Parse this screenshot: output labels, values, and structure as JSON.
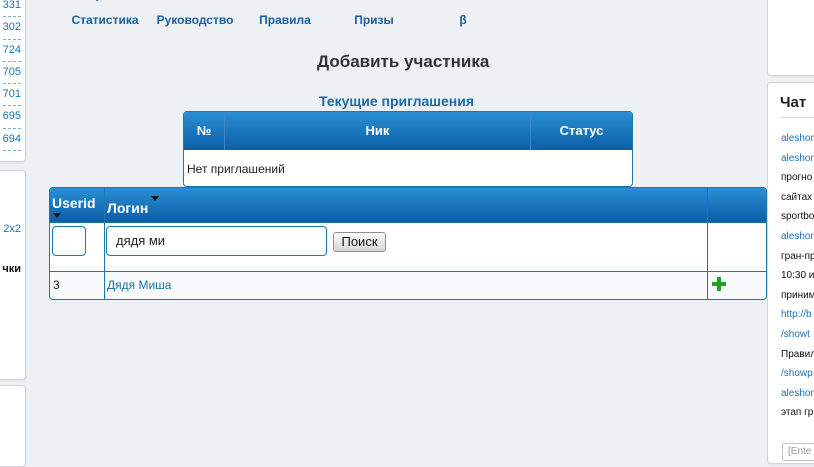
{
  "left_sidebar": {
    "numbers": [
      "331",
      "302",
      "724",
      "705",
      "701",
      "695",
      "694"
    ],
    "text1": "2x2",
    "text2": "чки"
  },
  "nav": {
    "items": [
      {
        "label": "Статистика",
        "icon": "chart-icon"
      },
      {
        "label": "Руководство",
        "icon": "manual-icon"
      },
      {
        "label": "Правила",
        "icon": "rules-icon"
      },
      {
        "label": "Призы",
        "icon": "gift-icon"
      },
      {
        "label": "β",
        "icon": "beta-icon"
      }
    ]
  },
  "page_title": "Добавить участника",
  "invitations": {
    "title": "Текущие приглашения",
    "columns": [
      "№",
      "Ник",
      "Статус"
    ],
    "empty_text": "Нет приглашений"
  },
  "users_table": {
    "columns": [
      "Userid",
      "Логин"
    ],
    "userid_filter_value": "",
    "login_filter_value": "дядя ми",
    "search_button": "Поиск",
    "rows": [
      {
        "id": "3",
        "login": "Дядя Миша"
      }
    ]
  },
  "chat": {
    "title": "Чат",
    "lines": [
      {
        "text": "aleshon",
        "type": "link"
      },
      {
        "text": "aleshon",
        "type": "link"
      },
      {
        "text": "прогно",
        "type": "text"
      },
      {
        "text": "сайтах",
        "type": "text"
      },
      {
        "text": "sportbo",
        "type": "text"
      },
      {
        "text": "aleshon",
        "type": "link"
      },
      {
        "text": "гран-пр",
        "type": "text"
      },
      {
        "text": "10:30 и",
        "type": "text"
      },
      {
        "text": "приним",
        "type": "text"
      },
      {
        "text": "http://b",
        "type": "link"
      },
      {
        "text": "/showt",
        "type": "link"
      },
      {
        "text": "Правил",
        "type": "text"
      },
      {
        "text": "/showp",
        "type": "link"
      },
      {
        "text": "aleshon",
        "type": "link"
      },
      {
        "text": "этап гр",
        "type": "text"
      }
    ],
    "input_placeholder": "[Ente"
  },
  "colors": {
    "header_blue": "#0b5ea8",
    "link_blue": "#1a73b5",
    "add_green": "#23a023"
  }
}
